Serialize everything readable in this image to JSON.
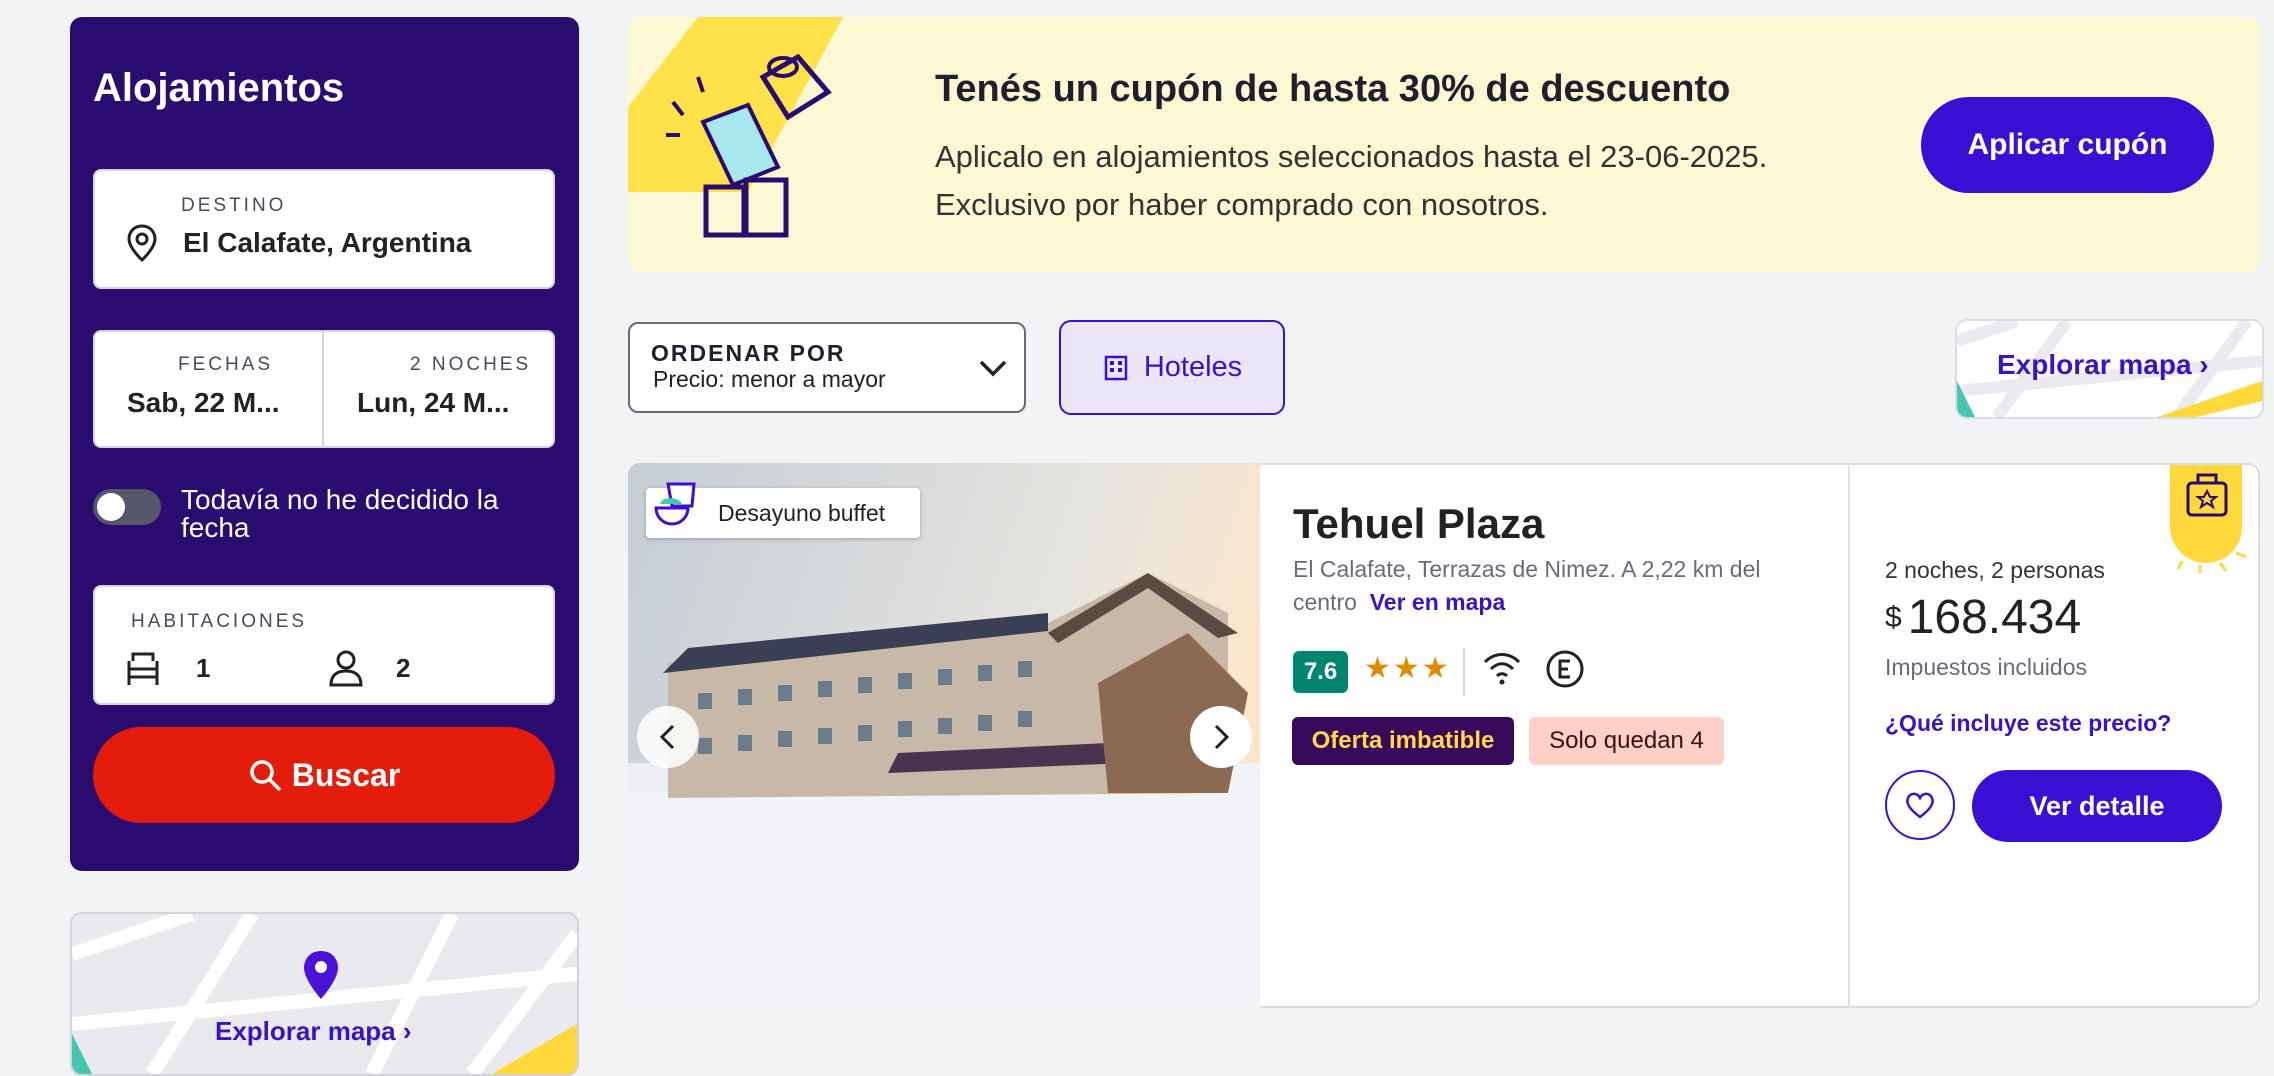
{
  "search_panel": {
    "title": "Alojamientos",
    "destination": {
      "label": "DESTINO",
      "value": "El Calafate, Argentina"
    },
    "dates": {
      "label": "FECHAS",
      "nights_label": "2 NOCHES",
      "checkin": "Sab, 22 M...",
      "checkout": "Lun, 24 M..."
    },
    "undecided_toggle": {
      "label": "Todavía no he decidido la fecha",
      "on": false
    },
    "rooms": {
      "label": "HABITACIONES",
      "rooms": "1",
      "guests": "2"
    },
    "search_button": "Buscar"
  },
  "side_map": {
    "link": "Explorar mapa ›"
  },
  "coupon_banner": {
    "title": "Tenés un cupón de hasta 30% de descuento",
    "line1": "Aplicalo en alojamientos seleccionados hasta el 23-06-2025.",
    "line2": "Exclusivo por haber comprado con nosotros.",
    "button": "Aplicar cupón"
  },
  "toolbar": {
    "sort_label": "ORDENAR POR",
    "sort_value": "Precio: menor a mayor",
    "hotels_filter": "Hoteles",
    "explore_map": "Explorar mapa ›"
  },
  "result": {
    "badge": "Desayuno buffet",
    "name": "Tehuel Plaza",
    "address": "El Calafate, Terrazas de Nimez. A 2,22 km del centro",
    "map_link": "Ver en mapa",
    "rating": "7.6",
    "stars": "★★★",
    "offer_tag": "Oferta imbatible",
    "availability_tag": "Solo quedan 4",
    "price": {
      "stay": "2 noches, 2 personas",
      "currency": "$",
      "amount": "168.434",
      "taxes": "Impuestos incluidos",
      "info_link": "¿Qué incluye este precio?"
    },
    "detail_button": "Ver detalle"
  },
  "colors": {
    "brand": "#3b0fd3",
    "panel": "#2a0b6f",
    "search": "#e41c0b",
    "banner": "#fdf8d4"
  }
}
